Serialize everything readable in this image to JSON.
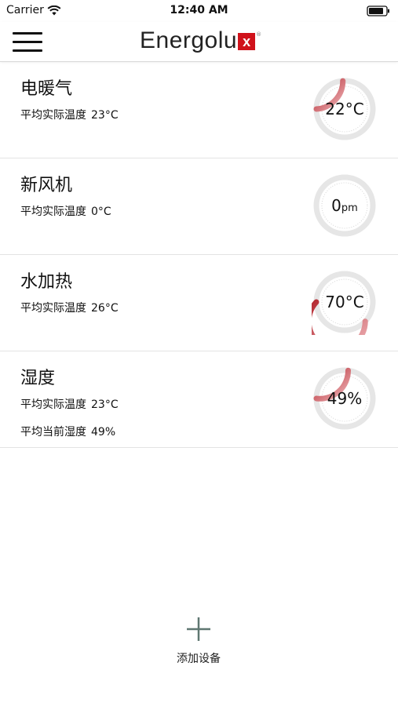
{
  "status_bar": {
    "carrier": "Carrier",
    "time": "12:40 AM"
  },
  "header": {
    "brand": "Energolu",
    "brand_mark": "x",
    "brand_reg": "®",
    "accent": "#d0121b"
  },
  "devices": [
    {
      "name": "电暖气",
      "metrics": [
        {
          "label": "平均实际温度",
          "value": "23°C"
        }
      ],
      "gauge": {
        "main": "22°C",
        "unit": "",
        "level": 0.24
      }
    },
    {
      "name": "新风机",
      "metrics": [
        {
          "label": "平均实际温度",
          "value": "0°C"
        }
      ],
      "gauge": {
        "main": "0",
        "unit": "pm",
        "level": 0
      }
    },
    {
      "name": "水加热",
      "metrics": [
        {
          "label": "平均实际温度",
          "value": "26°C"
        }
      ],
      "gauge": {
        "main": "70°C",
        "unit": "",
        "level": 0.62
      }
    },
    {
      "name": "湿度",
      "metrics": [
        {
          "label": "平均实际温度",
          "value": "23°C"
        },
        {
          "label": "平均当前湿度",
          "value": "49%"
        }
      ],
      "gauge": {
        "main": "49%",
        "unit": "",
        "level": 0.27
      }
    }
  ],
  "add_device": {
    "label": "添加设备"
  },
  "colors": {
    "gauge_track": "#e6e6e6",
    "gauge_fill": "#b3262e",
    "plus": "#5f7771"
  }
}
